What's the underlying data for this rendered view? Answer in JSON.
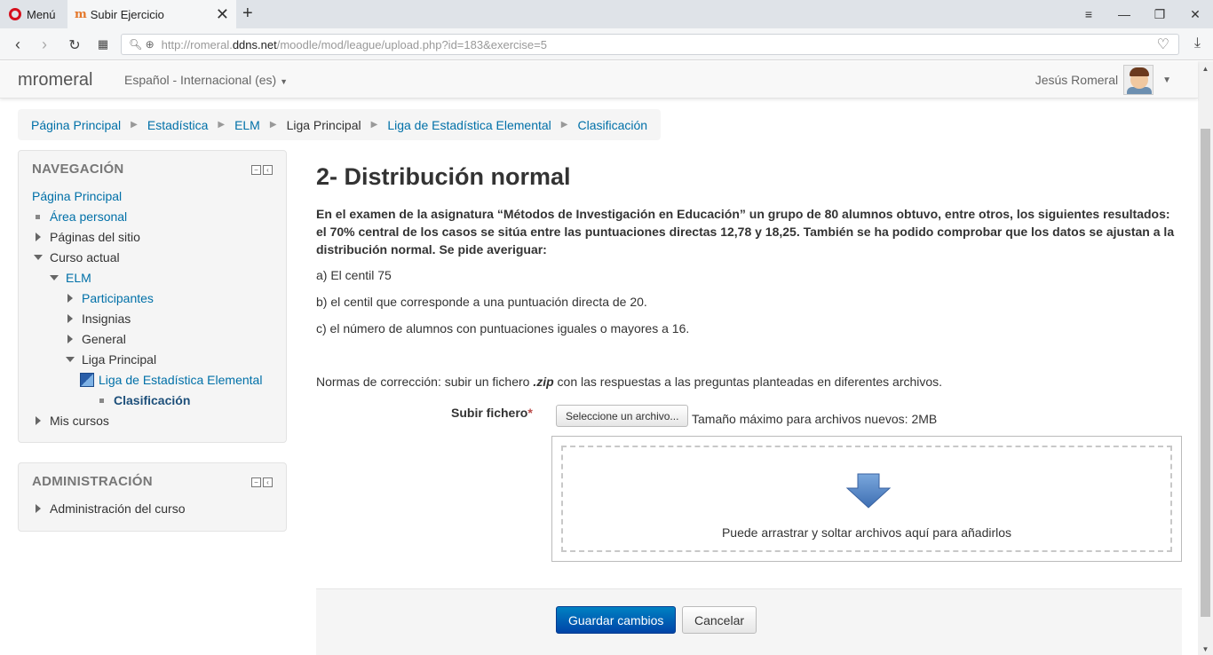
{
  "browser": {
    "menu_label": "Menú",
    "tab_title": "Subir Ejercicio",
    "url_prefix": "http://romeral.",
    "url_host": "ddns.net",
    "url_path": "/moodle/mod/league/upload.php?id=183&exercise=5"
  },
  "navbar": {
    "brand": "mromeral",
    "language": "Español - Internacional (es)",
    "user_name": "Jesús Romeral"
  },
  "breadcrumb": [
    {
      "label": "Página Principal",
      "link": true
    },
    {
      "label": "Estadística",
      "link": true
    },
    {
      "label": "ELM",
      "link": true
    },
    {
      "label": "Liga Principal",
      "link": false
    },
    {
      "label": "Liga de Estadística Elemental",
      "link": true
    },
    {
      "label": "Clasificación",
      "link": true
    }
  ],
  "navigation": {
    "title": "NAVEGACIÓN",
    "home": "Página Principal",
    "area_personal": "Área personal",
    "paginas_sitio": "Páginas del sitio",
    "curso_actual": "Curso actual",
    "elm": "ELM",
    "participantes": "Participantes",
    "insignias": "Insignias",
    "general": "General",
    "liga_principal": "Liga Principal",
    "liga_estadistica": "Liga de Estadística Elemental",
    "clasificacion": "Clasificación",
    "mis_cursos": "Mis cursos"
  },
  "administration": {
    "title": "ADMINISTRACIÓN",
    "admin_curso": "Administración del curso"
  },
  "main": {
    "title": "2- Distribución normal",
    "intro": "En el examen de la asignatura “Métodos de Investigación en Educación” un grupo de 80 alumnos obtuvo, entre otros, los siguientes resultados: el 70% central de los casos se sitúa entre las puntuaciones directas 12,78 y 18,25. También se ha podido comprobar que los datos se ajustan a la distribución normal. Se pide averiguar:",
    "item_a": "a) El centil 75",
    "item_b": "b) el centil que corresponde a una puntuación directa de 20.",
    "item_c": "c) el número de alumnos con puntuaciones iguales o mayores a 16.",
    "normas_pre": "Normas de corrección: subir un fichero ",
    "normas_zip": ".zip",
    "normas_post": " con las respuestas a las preguntas planteadas en diferentes archivos."
  },
  "upload": {
    "label": "Subir fichero",
    "required_mark": "*",
    "choose_button": "Seleccione un archivo...",
    "max_size": "Tamaño máximo para archivos nuevos: 2MB",
    "drop_text": "Puede arrastrar y soltar archivos aquí para añadirlos"
  },
  "actions": {
    "save": "Guardar cambios",
    "cancel": "Cancelar"
  },
  "colors": {
    "link": "#0070a8",
    "primary_button": "#0055b3",
    "opera_red": "#d5101d"
  }
}
